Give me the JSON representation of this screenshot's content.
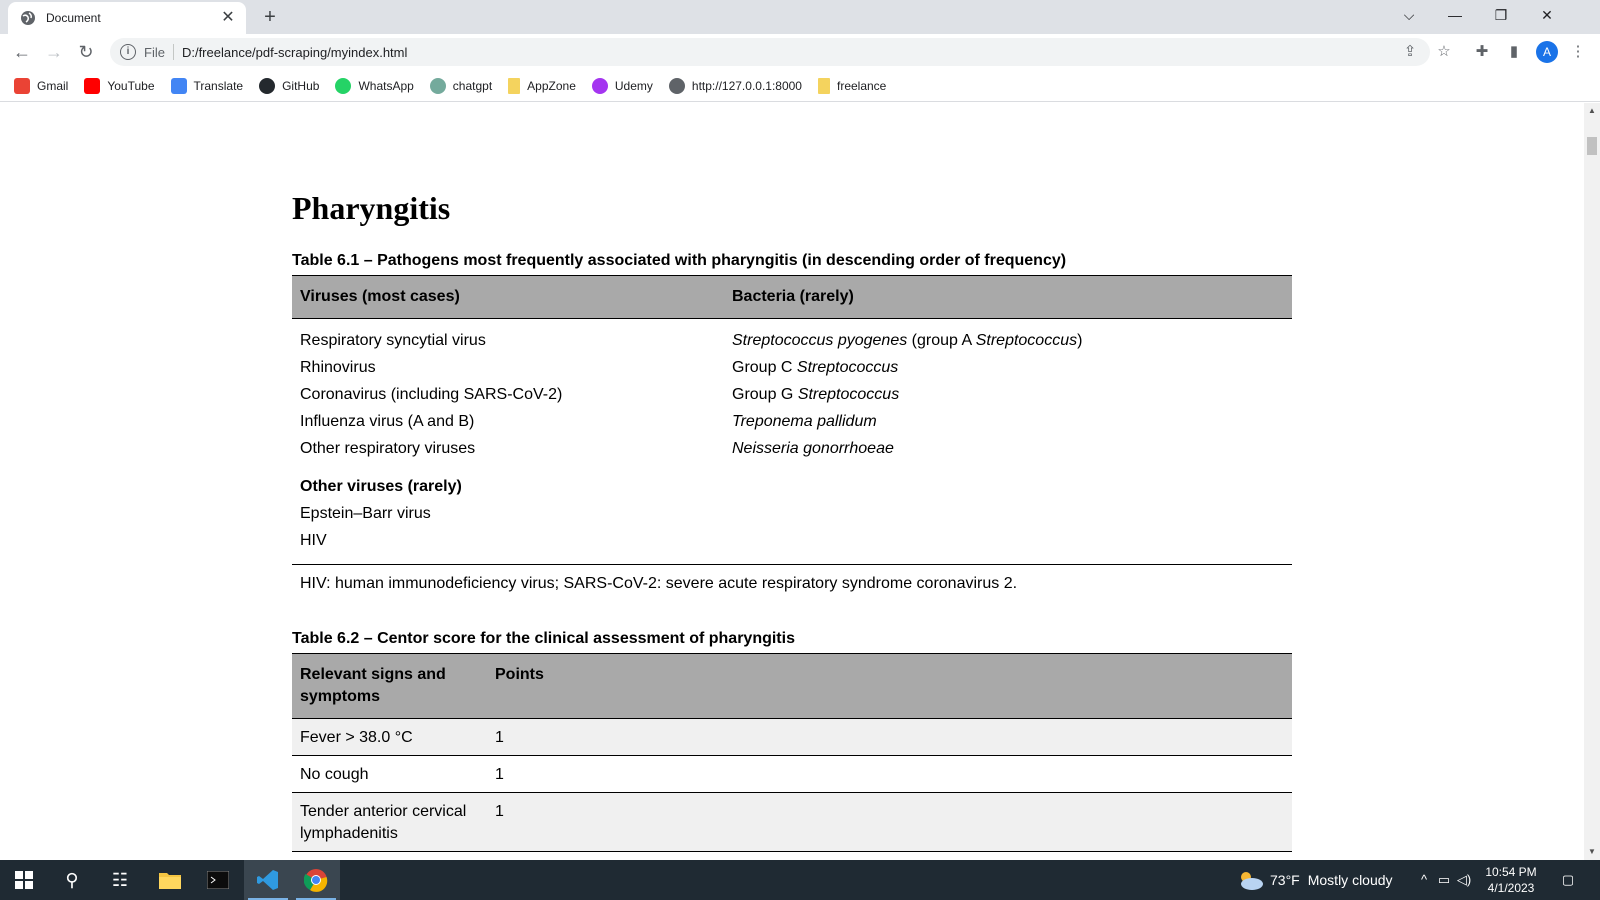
{
  "browser": {
    "tab_title": "Document",
    "url_scheme": "File",
    "url": "D:/freelance/pdf-scraping/myindex.html",
    "profile_initial": "A",
    "bookmarks": [
      {
        "label": "Gmail",
        "icon": "gmail-icon",
        "color": "#ea4335"
      },
      {
        "label": "YouTube",
        "icon": "youtube-icon",
        "color": "#ff0000"
      },
      {
        "label": "Translate",
        "icon": "translate-icon",
        "color": "#4285f4"
      },
      {
        "label": "GitHub",
        "icon": "github-icon",
        "color": "#24292e"
      },
      {
        "label": "WhatsApp",
        "icon": "whatsapp-icon",
        "color": "#25d366"
      },
      {
        "label": "chatgpt",
        "icon": "chatgpt-icon",
        "color": "#74aa9c"
      },
      {
        "label": "AppZone",
        "icon": "folder-icon",
        "color": "#f4d35e"
      },
      {
        "label": "Udemy",
        "icon": "udemy-icon",
        "color": "#a435f0"
      },
      {
        "label": "http://127.0.0.1:8000",
        "icon": "globe-icon",
        "color": "#5f6368"
      },
      {
        "label": "freelance",
        "icon": "folder-icon",
        "color": "#f4d35e"
      }
    ]
  },
  "document": {
    "heading": "Pharyngitis",
    "table1": {
      "caption": "Table 6.1 – Pathogens most frequently associated with pharyngitis (in descending order of frequency)",
      "headers": [
        "Viruses (most cases)",
        "Bacteria (rarely)"
      ],
      "viruses": [
        "Respiratory syncytial virus",
        "Rhinovirus",
        "Coronavirus (including SARS-CoV-2)",
        "Influenza virus (A and B)",
        "Other respiratory viruses"
      ],
      "bacteria": {
        "row1_a": "Streptococcus pyogenes",
        "row1_b": " (group A ",
        "row1_c": "Streptococcus",
        "row1_d": ")",
        "row2_a": "Group C ",
        "row2_b": "Streptococcus",
        "row3_a": "Group G ",
        "row3_b": "Streptococcus",
        "row4": "Treponema pallidum",
        "row5": "Neisseria gonorrhoeae"
      },
      "other_viruses_heading": "Other viruses (rarely)",
      "other_viruses": [
        "Epstein–Barr virus",
        "HIV"
      ],
      "footnote": "HIV: human immunodeficiency virus; SARS-CoV-2: severe acute respiratory syndrome coronavirus 2."
    },
    "table2": {
      "caption": "Table 6.2 – Centor score for the clinical assessment of pharyngitis",
      "headers": [
        "Relevant signs and symptoms",
        "Points"
      ],
      "rows": [
        {
          "sign": "Fever > 38.0 °C",
          "points": "1"
        },
        {
          "sign": "No cough",
          "points": "1"
        },
        {
          "sign": "Tender anterior cervical lymphadenitis",
          "points": "1"
        }
      ]
    }
  },
  "taskbar": {
    "weather_temp": "73°F",
    "weather_desc": "Mostly cloudy",
    "time": "10:54 PM",
    "date": "4/1/2023"
  }
}
